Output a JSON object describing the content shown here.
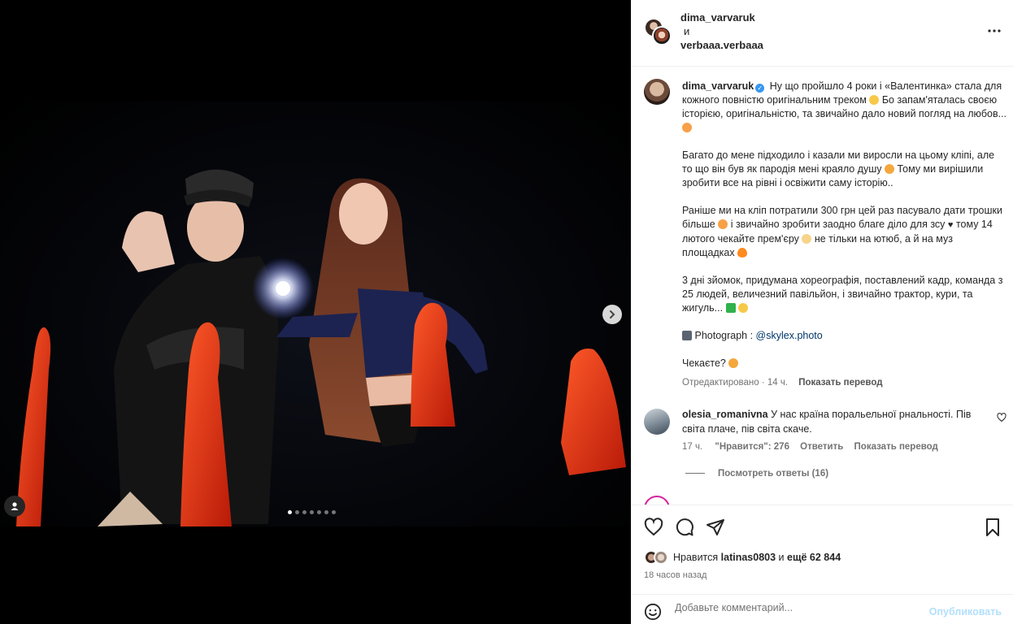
{
  "header": {
    "author1": "dima_varvaruk",
    "and_word": "и",
    "author2": "verbaaa.verbaaa",
    "more_icon": "more-horizontal-icon"
  },
  "media": {
    "next_icon": "chevron-right-icon",
    "tag_icon": "user-tag-icon",
    "carousel_count": 7,
    "carousel_active": 0
  },
  "caption": {
    "username": "dima_varvaruk",
    "p1": "Ну що пройшло 4 роки і «Валентинка» стала для кожного повністю оригінальним треком",
    "p1b": "Бо запам'яталась своєю історією, оригінальністю, та звичайно дало новий погляд на любов...",
    "p2a": "Багато до мене підходило і казали ми виросли на цьому кліпі, але то що він був як пародія мені краяло душу",
    "p2b": "Тому ми вирішили зробити все на рівні і освіжити саму історію..",
    "p3a": "Раніше ми на кліп потратили 300 грн цей раз пасувало дати трошки більше",
    "p3b": " і звичайно зробити заодно благе діло для зсу",
    "p3c": " тому 14 лютого чекайте прем'єру",
    "p3d": " не тільки на ютюб, а й на муз площадках",
    "p4": "3 дні зйомок, придумана хореографія, поставлений кадр, команда з 25 людей, величезний павільйон, і звичайно трактор, кури, та жигуль...",
    "photo_label": "Photograph : ",
    "photo_link": "@skylex.photo",
    "p6": "Чекаєте?",
    "edited": "Отредактировано · 14 ч.",
    "translate": "Показать перевод"
  },
  "comment": {
    "username": "olesia_romanivna",
    "text": "У нас країна поральельної рнальності. Пів світа плаче, пів світа скаче.",
    "time": "17 ч.",
    "likes": "\"Нравится\": 276",
    "reply": "Ответить",
    "translate": "Показать перевод",
    "view_replies": "Посмотреть ответы (16)"
  },
  "actions": {
    "like_icon": "heart-icon",
    "comment_icon": "comment-icon",
    "share_icon": "send-icon",
    "save_icon": "bookmark-icon"
  },
  "likes": {
    "prefix": "Нравится ",
    "user": "latinas0803",
    "middle": " и ",
    "others": "ещё 62 844"
  },
  "time_ago": "18 часов назад",
  "add_comment": {
    "placeholder": "Добавьте комментарий...",
    "publish": "Опубликовать",
    "emoji_icon": "smile-icon"
  },
  "colors": {
    "accent": "#0095f6",
    "link": "#00376b",
    "muted": "#737373"
  }
}
